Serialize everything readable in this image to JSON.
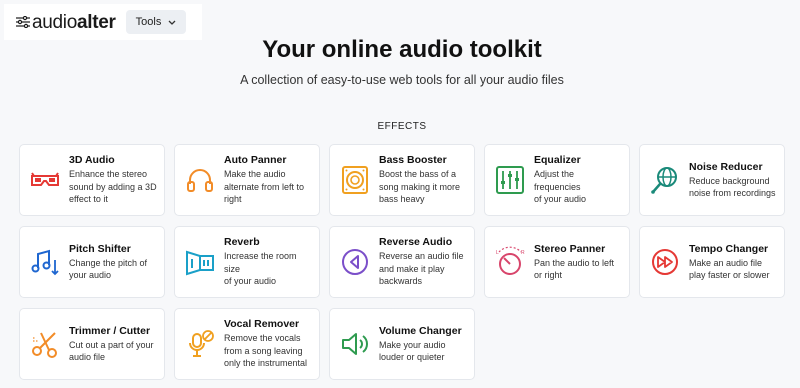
{
  "header": {
    "logo_text_light": "audio",
    "logo_text_bold": "alter",
    "tools_label": "Tools"
  },
  "hero": {
    "title": "Your online audio toolkit",
    "subtitle": "A collection of easy-to-use web tools for all your audio files"
  },
  "effects": {
    "section_label": "EFFECTS",
    "items": [
      {
        "title": "3D Audio",
        "desc": [
          "Enhance the stereo",
          "sound by adding a 3D",
          "effect to it"
        ],
        "icon": "3d-glasses-icon",
        "color": "#e53935"
      },
      {
        "title": "Auto Panner",
        "desc": [
          "Make the audio",
          "alternate from left to",
          "right"
        ],
        "icon": "headphones-icon",
        "color": "#f28c28"
      },
      {
        "title": "Bass Booster",
        "desc": [
          "Boost the bass of a",
          "song making it more",
          "bass heavy"
        ],
        "icon": "speaker-icon",
        "color": "#f0a020"
      },
      {
        "title": "Equalizer",
        "desc": [
          "Adjust the frequencies",
          "of your audio"
        ],
        "icon": "equalizer-icon",
        "color": "#2e9b4f"
      },
      {
        "title": "Noise Reducer",
        "desc": [
          "Reduce background",
          "noise from recordings"
        ],
        "icon": "globe-mic-icon",
        "color": "#1a8a7a"
      },
      {
        "title": "Pitch Shifter",
        "desc": [
          "Change the pitch of",
          "your audio"
        ],
        "icon": "music-notes-icon",
        "color": "#1e66d0"
      },
      {
        "title": "Reverb",
        "desc": [
          "Increase the room size",
          "of your audio"
        ],
        "icon": "reverb-icon",
        "color": "#1aa0c8"
      },
      {
        "title": "Reverse Audio",
        "desc": [
          "Reverse an audio file",
          "and make it play",
          "backwards"
        ],
        "icon": "reverse-icon",
        "color": "#7b4fc9"
      },
      {
        "title": "Stereo Panner",
        "desc": [
          "Pan the audio to left",
          "or right"
        ],
        "icon": "pan-knob-icon",
        "color": "#d8456b"
      },
      {
        "title": "Tempo Changer",
        "desc": [
          "Make an audio file",
          "play faster or slower"
        ],
        "icon": "fast-forward-icon",
        "color": "#e53935"
      },
      {
        "title": "Trimmer / Cutter",
        "desc": [
          "Cut out a part of your",
          "audio file"
        ],
        "icon": "scissors-icon",
        "color": "#f28c28"
      },
      {
        "title": "Vocal Remover",
        "desc": [
          "Remove the vocals",
          "from a song leaving",
          "only the instrumental"
        ],
        "icon": "mic-off-icon",
        "color": "#f0a020"
      },
      {
        "title": "Volume Changer",
        "desc": [
          "Make your audio",
          "louder or quieter"
        ],
        "icon": "volume-icon",
        "color": "#2e9b4f"
      }
    ]
  }
}
